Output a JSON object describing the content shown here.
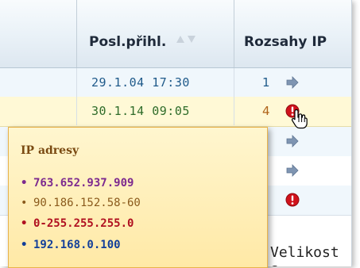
{
  "columns": {
    "last_login_header": "Posl.přihl.",
    "ip_ranges_header": "Rozsahy IP"
  },
  "rows": [
    {
      "last_login": "29.1.04 17:30",
      "ip_range_count": "1",
      "icon": "arrow-right-icon"
    },
    {
      "last_login": "30.1.14 09:05",
      "ip_range_count": "4",
      "icon": "alert-icon"
    },
    {
      "icon": "arrow-right-icon"
    },
    {
      "icon": "arrow-right-icon"
    },
    {
      "icon": "alert-icon"
    }
  ],
  "tooltip": {
    "title": "IP adresy",
    "items": [
      {
        "text": "763.652.937.909",
        "color": "#7d2a8f"
      },
      {
        "text": "90.186.152.58-60",
        "color": "#8a5a1c"
      },
      {
        "text": "0-255.255.255.0",
        "color": "#b01020"
      },
      {
        "text": "192.168.0.100",
        "color": "#123f9a"
      }
    ]
  },
  "footer_text": "Velikost s",
  "colors": {
    "header_bg": "#e9f1f7",
    "highlight_row": "#fff9d6",
    "tooltip_bg": "#ffe9a6",
    "alert": "#d0121b",
    "arrow": "#7f95b2"
  }
}
